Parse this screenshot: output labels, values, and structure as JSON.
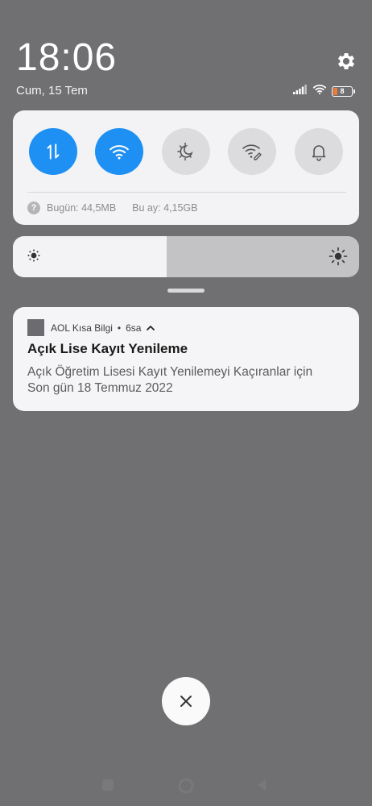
{
  "status": {
    "time": "18:06",
    "date": "Cum, 15 Tem",
    "battery_level": "8",
    "icons": [
      "signal-icon",
      "wifi-icon",
      "battery-icon"
    ]
  },
  "settings": {
    "icon": "gear-icon"
  },
  "quick_settings": {
    "toggles": [
      {
        "name": "mobile-data",
        "icon": "data-arrows-icon",
        "active": true
      },
      {
        "name": "wifi",
        "icon": "wifi-icon",
        "active": true
      },
      {
        "name": "dark-mode",
        "icon": "moon-sun-icon",
        "active": false
      },
      {
        "name": "wifi-edit",
        "icon": "wifi-pencil-icon",
        "active": false
      },
      {
        "name": "bell",
        "icon": "bell-icon",
        "active": false
      }
    ],
    "usage_today": "Bugün: 44,5MB",
    "usage_month": "Bu ay: 4,15GB",
    "help_glyph": "?"
  },
  "brightness": {
    "level": 0.445
  },
  "notification": {
    "app_name": "AOL Kısa Bilgi",
    "separator": "•",
    "time_ago": "6sa",
    "expand_glyph": "^",
    "title": "Açık Lise Kayıt Yenileme",
    "body_line1": "Açık Öğretim Lisesi Kayıt Yenilemeyi Kaçıranlar için",
    "body_line2": "Son gün 18 Temmuz 2022"
  },
  "colors": {
    "background": "#706f72",
    "accent": "#1e90f3",
    "panel": "#f3f3f5",
    "battery_low": "#f07a3a"
  }
}
